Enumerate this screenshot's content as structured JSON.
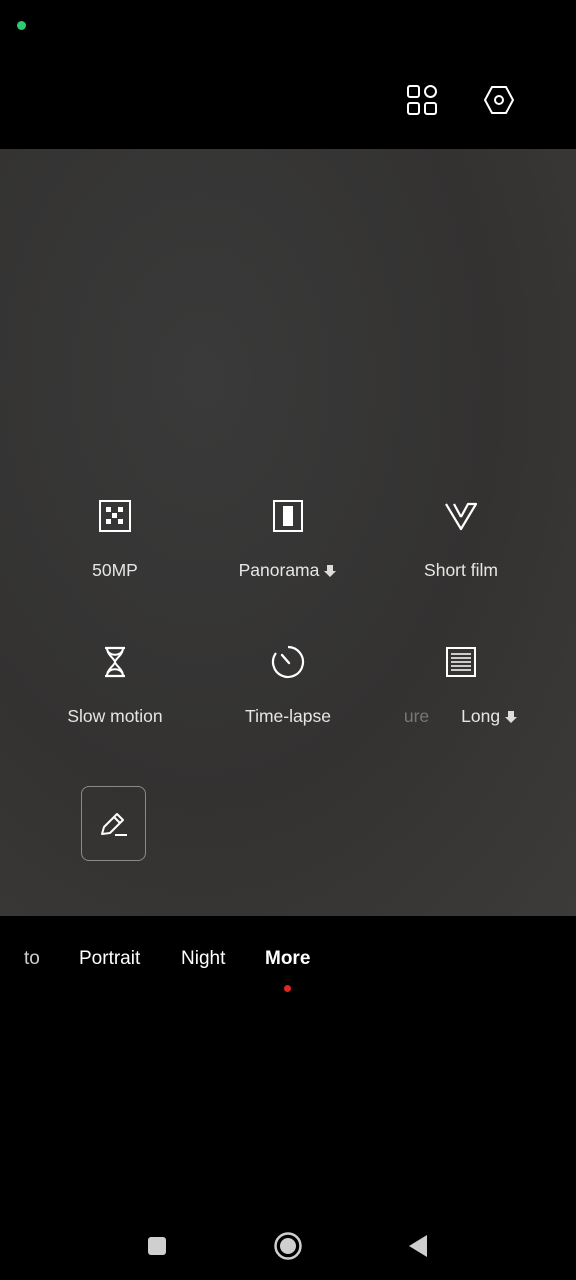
{
  "status": {
    "indicator_color": "#2ecc71"
  },
  "top_bar": {
    "icons": [
      "grid-icon",
      "settings-hexagon-icon"
    ]
  },
  "modes_grid": [
    {
      "label": "50MP",
      "icon": "pixel-grid-icon",
      "download": false
    },
    {
      "label": "Panorama",
      "icon": "panorama-icon",
      "download": true
    },
    {
      "label": "Short film",
      "icon": "short-film-v-icon",
      "download": false
    },
    {
      "label": "Slow motion",
      "icon": "hourglass-icon",
      "download": false
    },
    {
      "label": "Time-lapse",
      "icon": "timer-dial-icon",
      "download": false
    },
    {
      "label_left": "ure",
      "label_right": "Long",
      "icon": "long-exposure-icon",
      "download": true
    }
  ],
  "edit_button": {
    "icon": "edit-pencil-icon"
  },
  "mode_bar": {
    "tabs": [
      "to",
      "Portrait",
      "Night",
      "More"
    ],
    "active": "More",
    "active_color": "#e0281f"
  },
  "nav_bar": {
    "icons": [
      "recents-square-icon",
      "home-circle-icon",
      "back-triangle-icon"
    ]
  }
}
